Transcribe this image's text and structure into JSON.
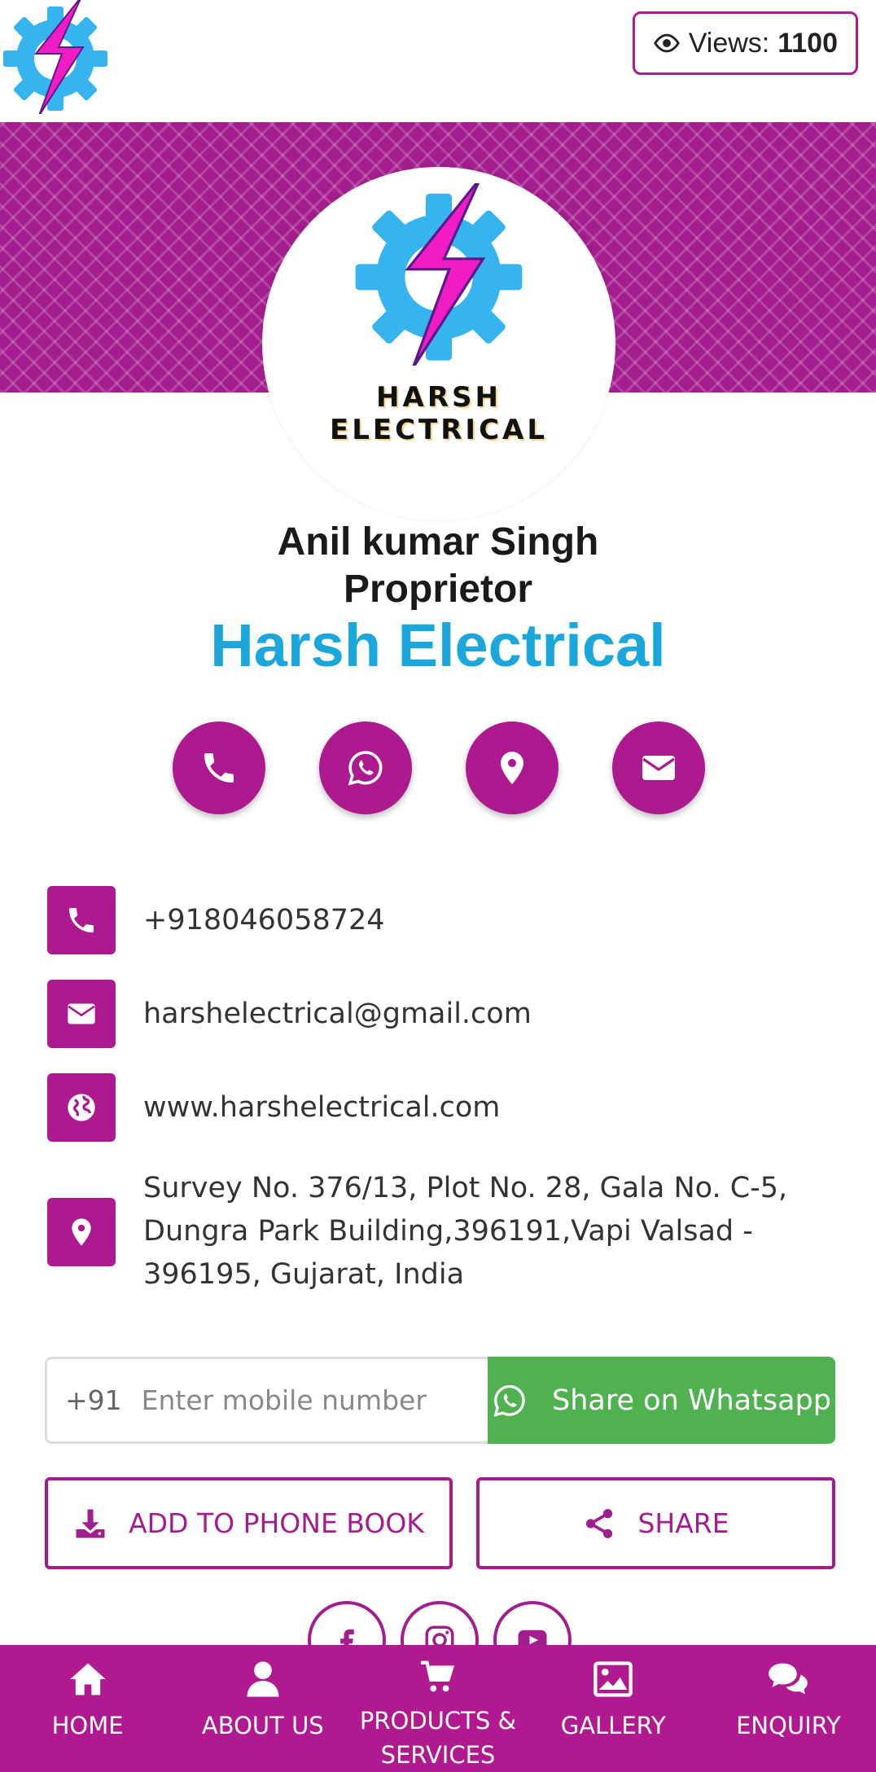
{
  "header": {
    "views_label": "Views:",
    "views_count": "1100"
  },
  "profile": {
    "logo_text": "HARSH ELECTRICAL",
    "name": "Anil kumar Singh",
    "role": "Proprietor",
    "company": "Harsh Electrical"
  },
  "contact": {
    "phone": "+918046058724",
    "email": "harshelectrical@gmail.com",
    "website": "www.harshelectrical.com",
    "address": "Survey No. 376/13, Plot No. 28, Gala No. C-5, Dungra Park Building,396191,Vapi Valsad - 396195, Gujarat, India"
  },
  "share": {
    "country_code": "+91",
    "mobile_placeholder": "Enter mobile number",
    "mobile_value": "",
    "whatsapp_button": "Share on Whatsapp"
  },
  "actions": {
    "add_to_phone_book": "ADD TO PHONE BOOK",
    "share": "SHARE"
  },
  "bottom_nav": {
    "items": [
      {
        "label": "HOME",
        "icon": "home-icon"
      },
      {
        "label": "ABOUT US",
        "icon": "user-icon"
      },
      {
        "label": "PRODUCTS & SERVICES",
        "icon": "cart-icon"
      },
      {
        "label": "GALLERY",
        "icon": "image-icon"
      },
      {
        "label": "ENQUIRY",
        "icon": "chat-icon"
      }
    ]
  },
  "colors": {
    "brand_magenta": "#ad1a8f",
    "brand_blue": "#1ba6dc",
    "whatsapp_green": "#4fb14f",
    "logo_gear_blue": "#35b4f0",
    "logo_bolt_pink": "#f21cc4"
  }
}
